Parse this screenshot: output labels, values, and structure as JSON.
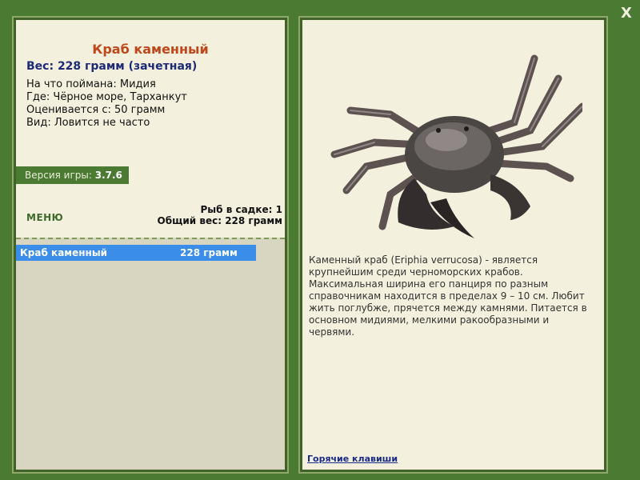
{
  "window": {
    "close_label": "X"
  },
  "fish": {
    "title": "Краб каменный",
    "weight": "Вес: 228 грамм (зачетная)",
    "details": [
      "На что поймана: Мидия",
      "Где: Чёрное море, Тарханкут",
      "Оценивается с: 50 грамм",
      "Вид: Ловится не часто"
    ]
  },
  "version": {
    "label": "Версия игры: ",
    "value": "3.7.6"
  },
  "menu": {
    "label": "МЕНЮ"
  },
  "cage": {
    "count": "Рыб в садке: 1",
    "total": "Общий вес: 228 грамм"
  },
  "catch_list": [
    {
      "name": "Краб каменный",
      "weight": "228 грамм"
    }
  ],
  "description": "Каменный краб (Eriphia verrucosa) - является крупнейшим среди черноморских крабов. Максимальная ширина его панциря по разным справочникам находится в пределах 9 – 10 см. Любит жить поглубже, прячется между камнями. Питается в основном мидиями, мелкими ракообразными и червями.",
  "hotkeys_label": "Горячие клавиши",
  "colors": {
    "accent": "#c0471b",
    "panel_bg": "#f3f1dd",
    "frame": "#4b7a33",
    "selection": "#3a8de8"
  }
}
